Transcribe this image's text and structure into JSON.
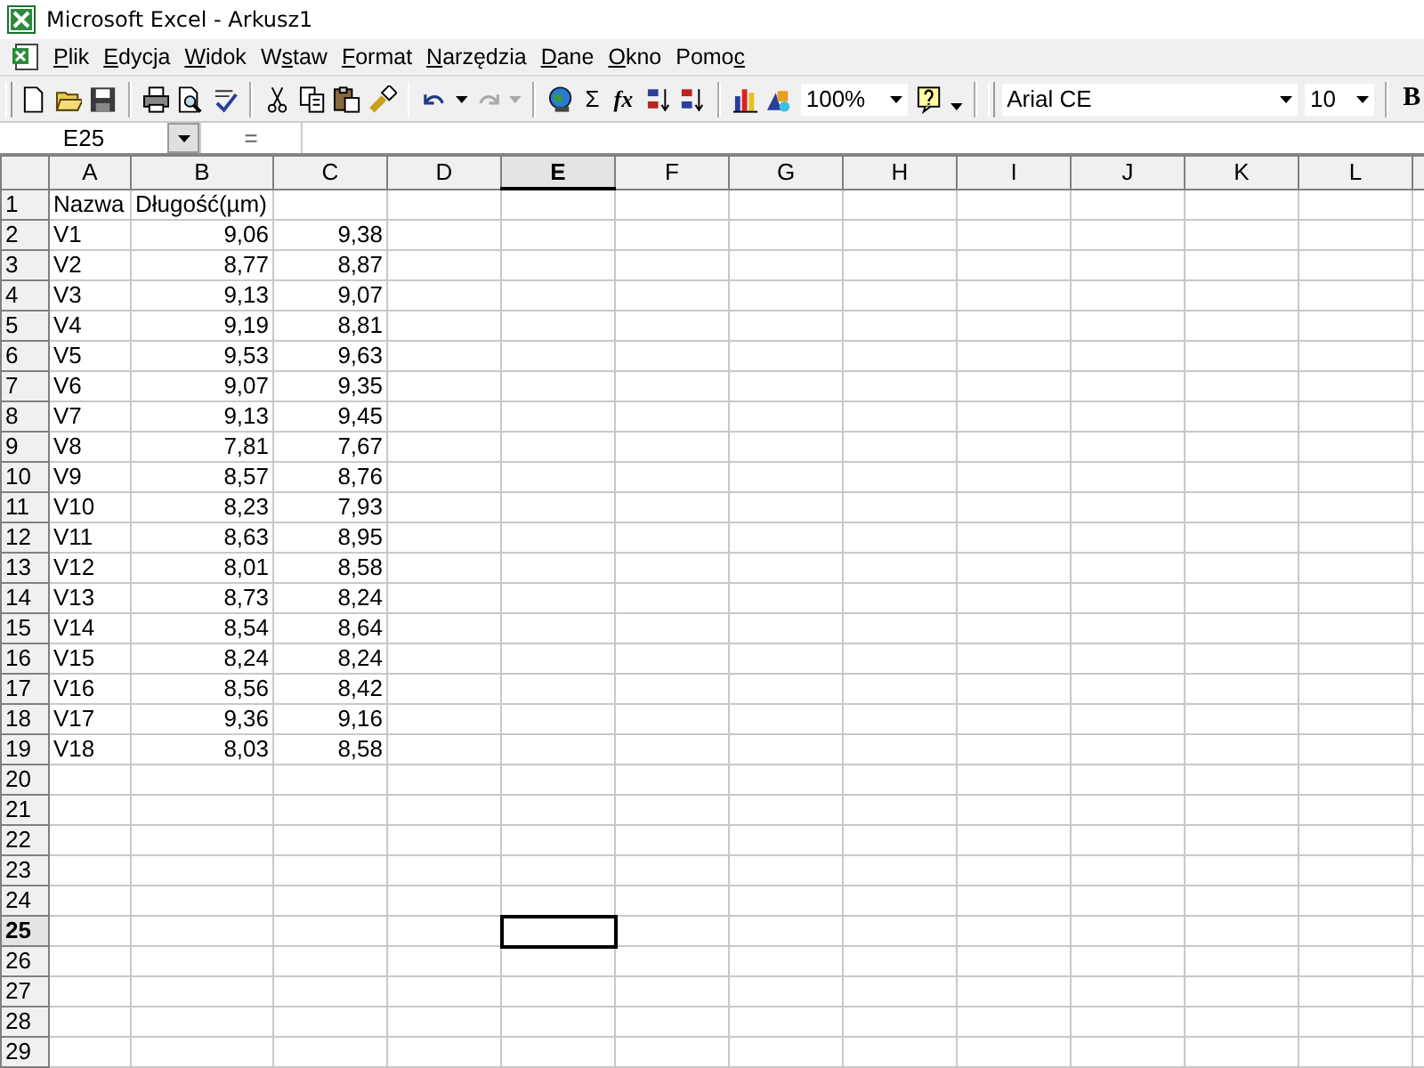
{
  "window": {
    "title": "Microsoft Excel - Arkusz1"
  },
  "menu": [
    {
      "key": "P",
      "after": "lik"
    },
    {
      "key": "E",
      "after": "dycja"
    },
    {
      "key": "W",
      "after": "idok"
    },
    {
      "before": "W",
      "key": "s",
      "after": "taw"
    },
    {
      "key": "F",
      "after": "ormat"
    },
    {
      "key": "N",
      "after": "arzędzia"
    },
    {
      "key": "D",
      "after": "ane"
    },
    {
      "key": "O",
      "after": "kno"
    },
    {
      "before": "Pomo",
      "key": "c"
    }
  ],
  "toolbar": {
    "sum": "Σ",
    "function": "fx",
    "zoom": "100%",
    "font": "Arial CE",
    "size": "10",
    "bold": "B",
    "redo_disabled": true
  },
  "formula_bar": {
    "name_box": "E25",
    "equals": "="
  },
  "columns": [
    {
      "label": "A",
      "selected": false
    },
    {
      "label": "B",
      "selected": false
    },
    {
      "label": "C",
      "selected": false
    },
    {
      "label": "D",
      "selected": false
    },
    {
      "label": "E",
      "selected": true
    },
    {
      "label": "F",
      "selected": false
    },
    {
      "label": "G",
      "selected": false
    },
    {
      "label": "H",
      "selected": false
    },
    {
      "label": "I",
      "selected": false
    },
    {
      "label": "J",
      "selected": false
    },
    {
      "label": "K",
      "selected": false
    },
    {
      "label": "L",
      "selected": false
    }
  ],
  "rows": [
    {
      "header": "1",
      "selected": false,
      "cells": [
        {
          "text": "Nazwa",
          "kind": "text"
        },
        {
          "text": "Długość(µm)",
          "kind": "text"
        }
      ]
    },
    {
      "header": "2",
      "selected": false,
      "cells": [
        {
          "text": "V1",
          "kind": "text"
        },
        {
          "text": "9,06",
          "kind": "number"
        },
        {
          "text": "9,38",
          "kind": "number"
        }
      ]
    },
    {
      "header": "3",
      "selected": false,
      "cells": [
        {
          "text": "V2",
          "kind": "text"
        },
        {
          "text": "8,77",
          "kind": "number"
        },
        {
          "text": "8,87",
          "kind": "number"
        }
      ]
    },
    {
      "header": "4",
      "selected": false,
      "cells": [
        {
          "text": "V3",
          "kind": "text"
        },
        {
          "text": "9,13",
          "kind": "number"
        },
        {
          "text": "9,07",
          "kind": "number"
        }
      ]
    },
    {
      "header": "5",
      "selected": false,
      "cells": [
        {
          "text": "V4",
          "kind": "text"
        },
        {
          "text": "9,19",
          "kind": "number"
        },
        {
          "text": "8,81",
          "kind": "number"
        }
      ]
    },
    {
      "header": "6",
      "selected": false,
      "cells": [
        {
          "text": "V5",
          "kind": "text"
        },
        {
          "text": "9,53",
          "kind": "number"
        },
        {
          "text": "9,63",
          "kind": "number"
        }
      ]
    },
    {
      "header": "7",
      "selected": false,
      "cells": [
        {
          "text": "V6",
          "kind": "text"
        },
        {
          "text": "9,07",
          "kind": "number"
        },
        {
          "text": "9,35",
          "kind": "number"
        }
      ]
    },
    {
      "header": "8",
      "selected": false,
      "cells": [
        {
          "text": "V7",
          "kind": "text"
        },
        {
          "text": "9,13",
          "kind": "number"
        },
        {
          "text": "9,45",
          "kind": "number"
        }
      ]
    },
    {
      "header": "9",
      "selected": false,
      "cells": [
        {
          "text": "V8",
          "kind": "text"
        },
        {
          "text": "7,81",
          "kind": "number"
        },
        {
          "text": "7,67",
          "kind": "number"
        }
      ]
    },
    {
      "header": "10",
      "selected": false,
      "cells": [
        {
          "text": "V9",
          "kind": "text"
        },
        {
          "text": "8,57",
          "kind": "number"
        },
        {
          "text": "8,76",
          "kind": "number"
        }
      ]
    },
    {
      "header": "11",
      "selected": false,
      "cells": [
        {
          "text": "V10",
          "kind": "text"
        },
        {
          "text": "8,23",
          "kind": "number"
        },
        {
          "text": "7,93",
          "kind": "number"
        }
      ]
    },
    {
      "header": "12",
      "selected": false,
      "cells": [
        {
          "text": "V11",
          "kind": "text"
        },
        {
          "text": "8,63",
          "kind": "number"
        },
        {
          "text": "8,95",
          "kind": "number"
        }
      ]
    },
    {
      "header": "13",
      "selected": false,
      "cells": [
        {
          "text": "V12",
          "kind": "text"
        },
        {
          "text": "8,01",
          "kind": "number"
        },
        {
          "text": "8,58",
          "kind": "number"
        }
      ]
    },
    {
      "header": "14",
      "selected": false,
      "cells": [
        {
          "text": "V13",
          "kind": "text"
        },
        {
          "text": "8,73",
          "kind": "number"
        },
        {
          "text": "8,24",
          "kind": "number"
        }
      ]
    },
    {
      "header": "15",
      "selected": false,
      "cells": [
        {
          "text": "V14",
          "kind": "text"
        },
        {
          "text": "8,54",
          "kind": "number"
        },
        {
          "text": "8,64",
          "kind": "number"
        }
      ]
    },
    {
      "header": "16",
      "selected": false,
      "cells": [
        {
          "text": "V15",
          "kind": "text"
        },
        {
          "text": "8,24",
          "kind": "number"
        },
        {
          "text": "8,24",
          "kind": "number"
        }
      ]
    },
    {
      "header": "17",
      "selected": false,
      "cells": [
        {
          "text": "V16",
          "kind": "text"
        },
        {
          "text": "8,56",
          "kind": "number"
        },
        {
          "text": "8,42",
          "kind": "number"
        }
      ]
    },
    {
      "header": "18",
      "selected": false,
      "cells": [
        {
          "text": "V17",
          "kind": "text"
        },
        {
          "text": "9,36",
          "kind": "number"
        },
        {
          "text": "9,16",
          "kind": "number"
        }
      ]
    },
    {
      "header": "19",
      "selected": false,
      "cells": [
        {
          "text": "V18",
          "kind": "text"
        },
        {
          "text": "8,03",
          "kind": "number"
        },
        {
          "text": "8,58",
          "kind": "number"
        }
      ]
    },
    {
      "header": "20",
      "selected": false
    },
    {
      "header": "21",
      "selected": false
    },
    {
      "header": "22",
      "selected": false
    },
    {
      "header": "23",
      "selected": false
    },
    {
      "header": "24",
      "selected": false
    },
    {
      "header": "25",
      "selected": true
    },
    {
      "header": "26",
      "selected": false
    },
    {
      "header": "27",
      "selected": false
    },
    {
      "header": "28",
      "selected": false
    },
    {
      "header": "29",
      "selected": false
    }
  ]
}
